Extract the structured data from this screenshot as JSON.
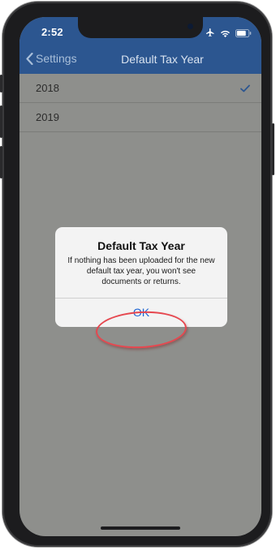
{
  "status_bar": {
    "time": "2:52",
    "icons": [
      "airplane-icon",
      "wifi-icon",
      "battery-icon"
    ]
  },
  "nav": {
    "back_label": "Settings",
    "title": "Default Tax Year"
  },
  "years": [
    {
      "label": "2018",
      "selected": true
    },
    {
      "label": "2019",
      "selected": false
    }
  ],
  "dialog": {
    "title": "Default Tax Year",
    "message": "If nothing has been uploaded for the new default tax year, you won't see documents or returns.",
    "ok_label": "OK"
  },
  "colors": {
    "nav_bar": "#2c5690",
    "dimmed_background": "#8e8f8c",
    "accent": "#1a66d6",
    "highlight": "#e6474f"
  }
}
